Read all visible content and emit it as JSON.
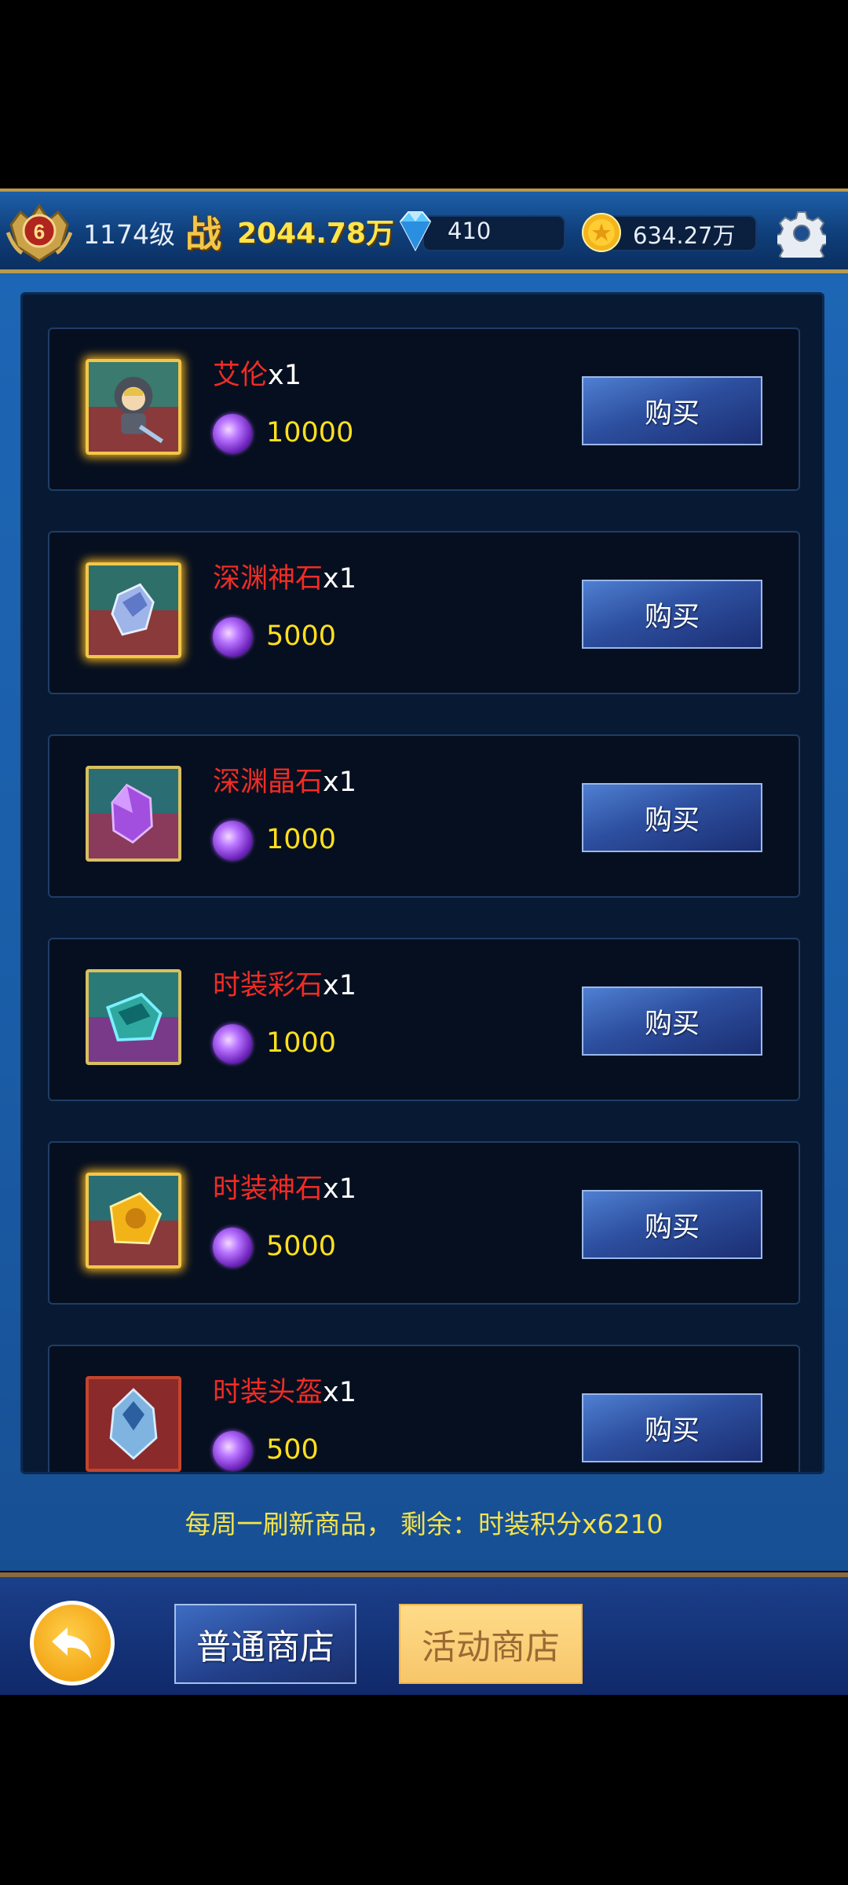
{
  "header": {
    "rank_level": "6",
    "player_level": "1174级",
    "power_icon_glyph": "战",
    "power_value": "2044.78万",
    "diamonds": "410",
    "gold": "634.27万"
  },
  "shop_items": [
    {
      "name": "艾伦",
      "qty": "x1",
      "price": "10000",
      "buy_label": "购买",
      "icon": "hooded-hero-icon"
    },
    {
      "name": "深渊神石",
      "qty": "x1",
      "price": "5000",
      "buy_label": "购买",
      "icon": "abyss-divine-stone-icon"
    },
    {
      "name": "深渊晶石",
      "qty": "x1",
      "price": "1000",
      "buy_label": "购买",
      "icon": "abyss-crystal-icon"
    },
    {
      "name": "时装彩石",
      "qty": "x1",
      "price": "1000",
      "buy_label": "购买",
      "icon": "fashion-color-stone-icon"
    },
    {
      "name": "时装神石",
      "qty": "x1",
      "price": "5000",
      "buy_label": "购买",
      "icon": "fashion-divine-stone-icon"
    },
    {
      "name": "时装头盔",
      "qty": "x1",
      "price": "500",
      "buy_label": "购买",
      "icon": "fashion-helmet-icon"
    }
  ],
  "footer_note": "每周一刷新商品， 剩余：时装积分x6210",
  "bottom_nav": {
    "normal_shop": "普通商店",
    "event_shop": "活动商店"
  },
  "colors": {
    "item_name": "#f02c25",
    "price": "#ffe01e",
    "note": "#f4e34a"
  }
}
